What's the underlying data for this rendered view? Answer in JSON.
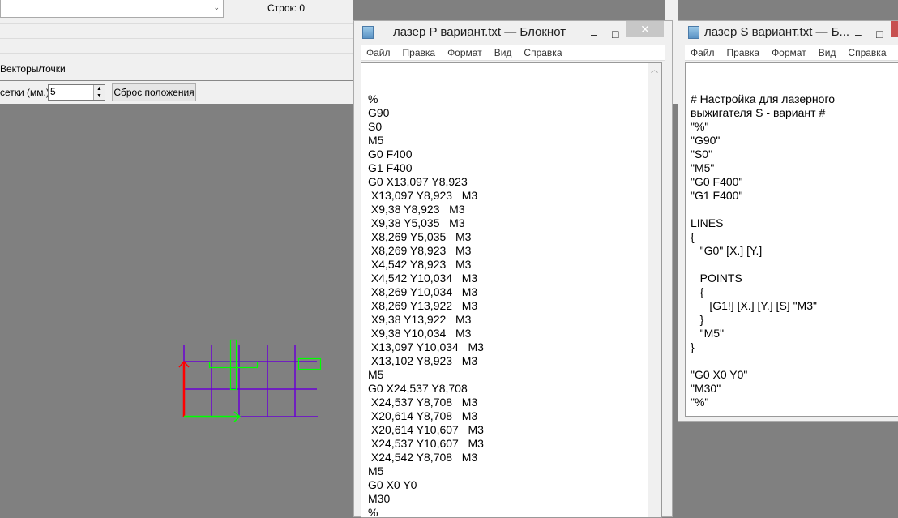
{
  "app": {
    "rows_label": "Строк: 0",
    "vectors_label": "Векторы/точки",
    "grid_label": "сетки (мм.):",
    "grid_value": "5",
    "reset_button": "Сброс положения"
  },
  "notepad_p": {
    "title": "лазер P вариант.txt — Блокнот",
    "menu": [
      "Файл",
      "Правка",
      "Формат",
      "Вид",
      "Справка"
    ],
    "content": "%\nG90\nS0\nM5\nG0 F400\nG1 F400\nG0 X13,097 Y8,923\n X13,097 Y8,923   M3\n X9,38 Y8,923   M3\n X9,38 Y5,035   M3\n X8,269 Y5,035   M3\n X8,269 Y8,923   M3\n X4,542 Y8,923   M3\n X4,542 Y10,034   M3\n X8,269 Y10,034   M3\n X8,269 Y13,922   M3\n X9,38 Y13,922   M3\n X9,38 Y10,034   M3\n X13,097 Y10,034   M3\n X13,102 Y8,923   M3\nM5\nG0 X24,537 Y8,708\n X24,537 Y8,708   M3\n X20,614 Y8,708   M3\n X20,614 Y10,607   M3\n X24,537 Y10,607   M3\n X24,542 Y8,708   M3\nM5\nG0 X0 Y0\nM30\n%"
  },
  "notepad_s": {
    "title": "лазер S вариант.txt — Б...",
    "menu": [
      "Файл",
      "Правка",
      "Формат",
      "Вид",
      "Справка"
    ],
    "content": "# Настройка для лазерного\nвыжигателя S - вариант #\n\"%\"\n\"G90\"\n\"S0\"\n\"M5\"\n\"G0 F400\"\n\"G1 F400\"\n\nLINES\n{\n   \"G0\" [X.] [Y.]\n\n   POINTS\n   {\n      [G1!] [X.] [Y.] [S] \"M3\"\n   }\n   \"M5\"\n}\n\n\"G0 X0 Y0\"\n\"M30\"\n\"%\""
  },
  "colors": {
    "grid": "#6a00d4",
    "x_axis": "#00ff00",
    "y_axis": "#ff0000",
    "shapes": "#00ff00",
    "canvas": "#808080"
  }
}
